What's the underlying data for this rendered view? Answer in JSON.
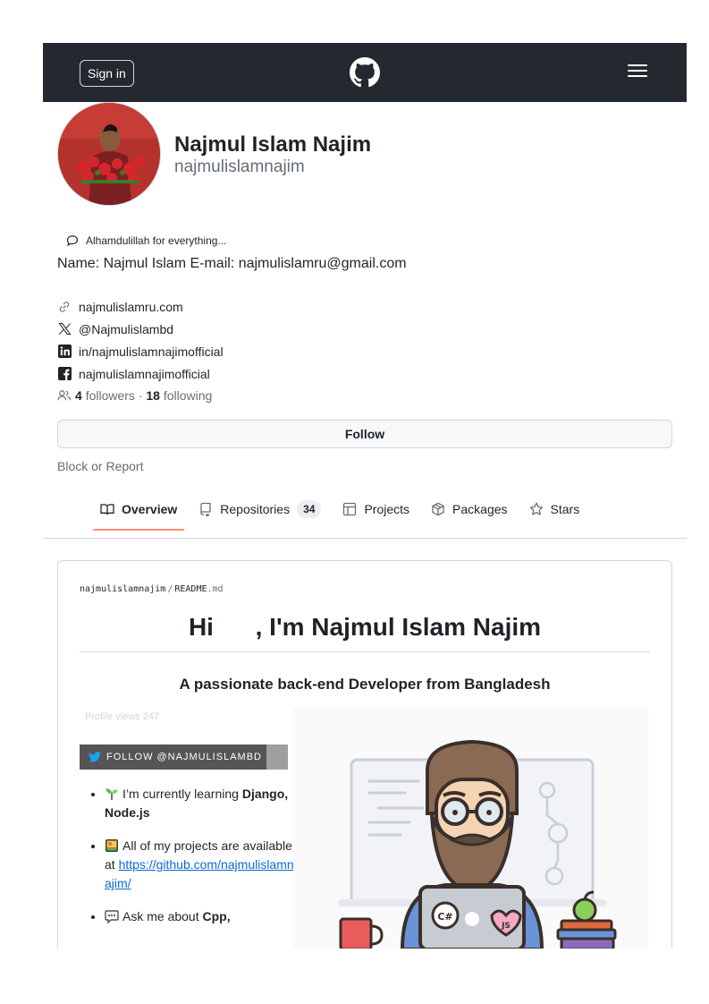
{
  "header": {
    "signin_label": "Sign in"
  },
  "profile": {
    "name": "Najmul Islam Najim",
    "username": "najmulislamnajim",
    "status": "Alhamdulillah for everything...",
    "bio": "Name: Najmul Islam E-mail: najmulislamru@gmail.com",
    "links": [
      {
        "icon": "link-icon",
        "text": "najmulislamru.com"
      },
      {
        "icon": "x-icon",
        "text": "@Najmulislambd"
      },
      {
        "icon": "linkedin-icon",
        "text": "in/najmulislamnajimofficial"
      },
      {
        "icon": "facebook-icon",
        "text": "najmulislamnajimofficial"
      }
    ],
    "followers_count": "4",
    "followers_label": "followers",
    "separator": "·",
    "following_count": "18",
    "following_label": "following",
    "follow_button": "Follow",
    "block_label": "Block or Report"
  },
  "tabs": [
    {
      "label": "Overview",
      "icon": "book-icon",
      "active": true
    },
    {
      "label": "Repositories",
      "icon": "repo-icon",
      "count": "34"
    },
    {
      "label": "Projects",
      "icon": "table-icon"
    },
    {
      "label": "Packages",
      "icon": "package-icon"
    },
    {
      "label": "Stars",
      "icon": "star-icon"
    }
  ],
  "readme": {
    "path_user": "najmulislamnajim",
    "path_sep": "/",
    "path_file": "README",
    "path_ext": ".md",
    "heading": "Hi      , I'm Najmul Islam Najim",
    "subheading": "A passionate back-end Developer from Bangladesh",
    "views": "Profile views  247",
    "twitter_badge": "FOLLOW @NAJMULISLAMBD",
    "items": [
      {
        "icon": "seedling-icon",
        "pre": "I’m currently learning ",
        "bold": "Django, Node.js"
      },
      {
        "icon": "projects-emoji-icon",
        "pre": "All of my projects are available at ",
        "link": "https://github.com/najmulislamnajim/"
      },
      {
        "icon": "speech-bubble-icon",
        "pre": "Ask me about ",
        "bold": "Cpp,"
      }
    ]
  },
  "colors": {
    "header_bg": "#24292f",
    "tab_underline": "#fd8c73",
    "link": "#0969da"
  }
}
